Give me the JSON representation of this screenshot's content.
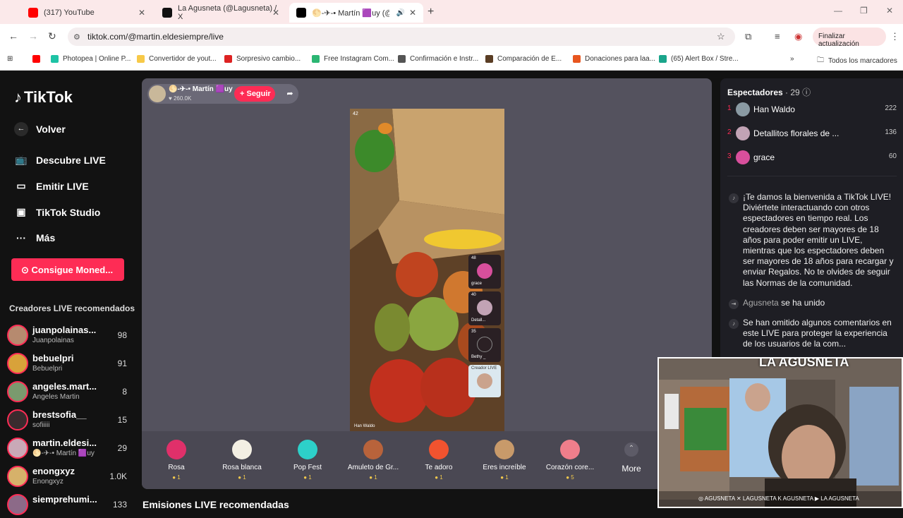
{
  "browser": {
    "tabs": [
      {
        "title": "(317) YouTube",
        "close": "✕"
      },
      {
        "title": "La Agusneta (@Lagusneta) / X",
        "close": "✕"
      },
      {
        "title": "🌕-✈-• Martín 🟪uy (@mar",
        "close": "✕"
      }
    ],
    "new_tab": "+",
    "url": "tiktok.com/@martin.eldesiempre/live",
    "update_label": "Finalizar actualización",
    "bookmarks": [
      "Photopea | Online P...",
      "Convertidor de yout...",
      "Sorpresivo cambio...",
      "Free Instagram Com...",
      "Confirmación e Instr...",
      "Comparación de E...",
      "Donaciones para laa...",
      "(65) Alert Box / Stre..."
    ],
    "bookmarks_all": "Todos los marcadores"
  },
  "sidebar": {
    "logo": "TikTok",
    "back": "Volver",
    "nav": [
      "Descubre LIVE",
      "Emitir LIVE",
      "TikTok Studio",
      "Más"
    ],
    "coins_button": "Consigue Moned...",
    "recommended_title": "Creadores LIVE recomendados",
    "creators": [
      {
        "name": "juanpolainas...",
        "sub": "Juanpolainas",
        "count": "98",
        "color": "#b68a6f"
      },
      {
        "name": "bebuelpri",
        "sub": "Bebuelpri",
        "count": "91",
        "color": "#d8a23a"
      },
      {
        "name": "angeles.mart...",
        "sub": "Angeles Martin",
        "count": "8",
        "color": "#7a9a6e"
      },
      {
        "name": "brestsofia__",
        "sub": "sofiiiii",
        "count": "15",
        "color": "#3a2b2e"
      },
      {
        "name": "martin.eldesi...",
        "sub": "🌕-✈-• Martín 🟪uy",
        "count": "29",
        "color": "#c9a9b7"
      },
      {
        "name": "enongxyz",
        "sub": "Enongxyz",
        "count": "1.0K",
        "color": "#d6b16a"
      },
      {
        "name": "siemprehumi...",
        "sub": "",
        "count": "133",
        "color": "#8c6a88"
      }
    ]
  },
  "live": {
    "host_name": "🌕-✈-• Martín 🟪uy",
    "host_likes": "♥ 260.0K",
    "follow": "+ Seguir",
    "video_viewers": "42",
    "video_label": "Han Waldo",
    "guests": [
      {
        "count": "48",
        "name": "grace"
      },
      {
        "count": "40",
        "name": "Detall..."
      },
      {
        "count": "35",
        "name": "Bethy _"
      },
      {
        "count": "",
        "name": "Creador LIVE"
      }
    ],
    "gifts": [
      {
        "name": "Rosa",
        "price": "1",
        "color": "#e0306a"
      },
      {
        "name": "Rosa blanca",
        "price": "1",
        "color": "#f3efe3"
      },
      {
        "name": "Pop Fest",
        "price": "1",
        "color": "#2dd0c9"
      },
      {
        "name": "Amuleto de Gr...",
        "price": "1",
        "color": "#b8633b"
      },
      {
        "name": "Te adoro",
        "price": "1",
        "color": "#f1532f"
      },
      {
        "name": "Eres increíble",
        "price": "1",
        "color": "#c89a6a"
      },
      {
        "name": "Corazón core...",
        "price": "5",
        "color": "#f07e8b"
      }
    ],
    "more": "More",
    "recommended_streams": "Emisiones LIVE recomendadas"
  },
  "chat": {
    "spectators_title": "Espectadores",
    "spectators_count": "· 29",
    "viewers": [
      {
        "rank": "1",
        "name": "Han Waldo",
        "score": "222",
        "color": "#8a9aa3"
      },
      {
        "rank": "2",
        "name": "Detallitos florales de ...",
        "score": "136",
        "color": "#c2a3b5"
      },
      {
        "rank": "3",
        "name": "grace",
        "score": "60",
        "color": "#d84f9c"
      }
    ],
    "messages": [
      {
        "text": "¡Te damos la bienvenida a TikTok LIVE! Diviértete interactuando con otros espectadores en tiempo real. Los creadores deben ser mayores de 18 años para poder emitir un LIVE, mientras que los espectadores deben ser mayores de 18 años para recargar y enviar Regalos. No te olvides de seguir las Normas de la comunidad."
      },
      {
        "user": "Agusneta",
        "text": "se ha unido"
      },
      {
        "text": "Se han omitido algunos comentarios en este LIVE para proteger la experiencia de los usuarios de la com..."
      }
    ]
  },
  "overlay": {
    "logo": "LA AGUSNETA",
    "socials": "◎ AGUSNETA   ✕ LAGUSNETA   K AGUSNETA   ▶ LA AGUSNETA"
  }
}
